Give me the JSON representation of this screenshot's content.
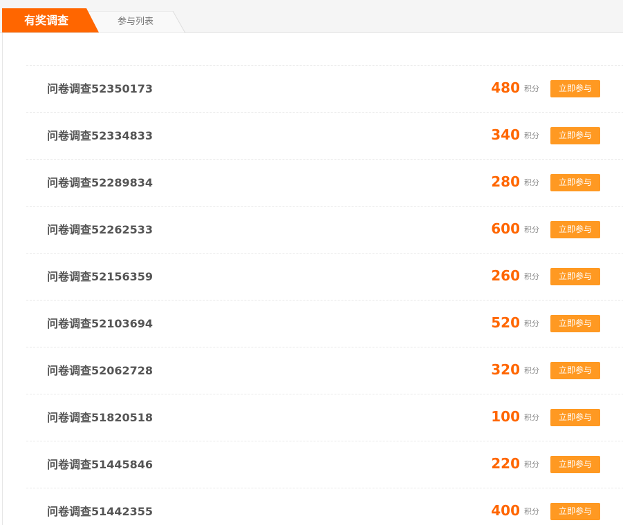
{
  "tabs": {
    "active_label": "有奖调查",
    "inactive_label": "参与列表"
  },
  "colors": {
    "accent": "#ff6600",
    "button": "#ff9922",
    "title_text": "#555555"
  },
  "unit_label": "积分",
  "button_label": "立即参与",
  "surveys": [
    {
      "title": "问卷调查52350173",
      "points": "480"
    },
    {
      "title": "问卷调查52334833",
      "points": "340"
    },
    {
      "title": "问卷调查52289834",
      "points": "280"
    },
    {
      "title": "问卷调查52262533",
      "points": "600"
    },
    {
      "title": "问卷调查52156359",
      "points": "260"
    },
    {
      "title": "问卷调查52103694",
      "points": "520"
    },
    {
      "title": "问卷调查52062728",
      "points": "320"
    },
    {
      "title": "问卷调查51820518",
      "points": "100"
    },
    {
      "title": "问卷调查51445846",
      "points": "220"
    },
    {
      "title": "问卷调查51442355",
      "points": "400"
    }
  ]
}
